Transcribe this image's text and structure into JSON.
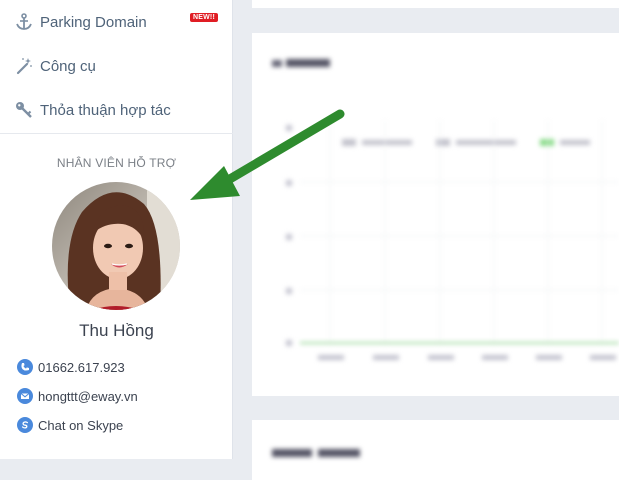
{
  "sidebar": {
    "items": [
      {
        "label": "Parking Domain",
        "icon": "anchor-icon",
        "badge": "NEW!!"
      },
      {
        "label": "Công cụ",
        "icon": "magic-wand-icon"
      },
      {
        "label": "Thỏa thuận hợp tác",
        "icon": "key-icon"
      }
    ]
  },
  "support": {
    "title": "NHÂN VIÊN HỖ TRỢ",
    "name": "Thu Hồng",
    "phone": "01662.617.923",
    "email": "hongttt@eway.vn",
    "skype": "Chat on Skype"
  },
  "colors": {
    "accent": "#4a89dc",
    "badge": "#e01d24",
    "arrow": "#2e8b2e"
  }
}
